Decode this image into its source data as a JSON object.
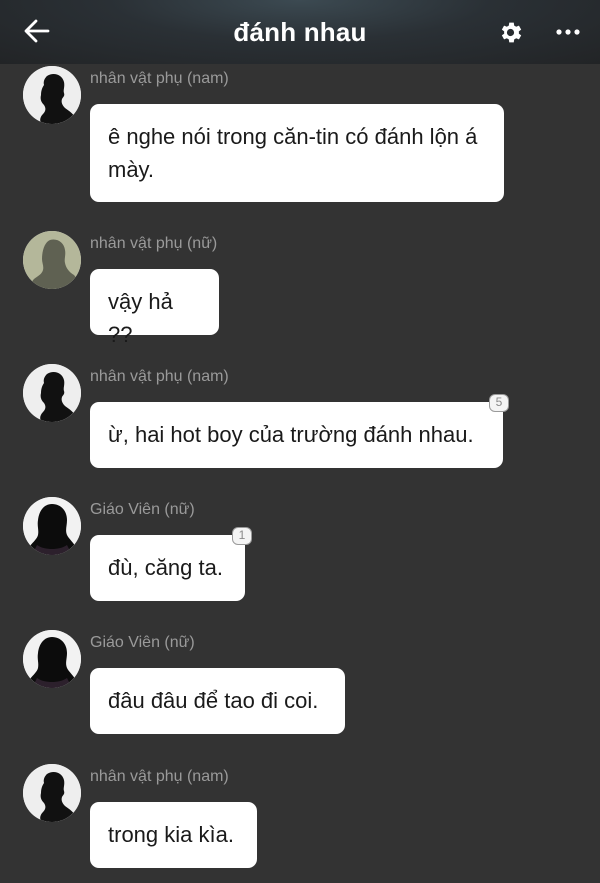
{
  "header": {
    "title": "đánh nhau",
    "back_icon": "arrow-left-icon",
    "settings_icon": "gear-icon",
    "more_icon": "more-horizontal-icon"
  },
  "messages": [
    {
      "name": "nhân vật phụ (nam)",
      "text": "ê nghe nói trong căn-tin có đánh lộn á mày.",
      "avatar": "male-silhouette-avatar",
      "badge": null
    },
    {
      "name": "nhân vật phụ (nữ)",
      "text": "vậy hả ??",
      "avatar": "female-silhouette-avatar",
      "badge": null
    },
    {
      "name": "nhân vật phụ (nam)",
      "text": "ừ, hai hot boy của trường đánh nhau.",
      "avatar": "male-silhouette-avatar",
      "badge": "5"
    },
    {
      "name": "Giáo Viên (nữ)",
      "text": "đù, căng ta.",
      "avatar": "teacher-silhouette-avatar",
      "badge": "1"
    },
    {
      "name": "Giáo Viên (nữ)",
      "text": "đâu đâu để tao đi coi.",
      "avatar": "teacher-silhouette-avatar",
      "badge": null
    },
    {
      "name": "nhân vật phụ (nam)",
      "text": "trong kia kìa.",
      "avatar": "male-silhouette-avatar",
      "badge": null
    }
  ],
  "colors": {
    "background": "#333333",
    "bubble": "#ffffff",
    "name_text": "#9a9a9a",
    "header_text": "#ffffff"
  }
}
